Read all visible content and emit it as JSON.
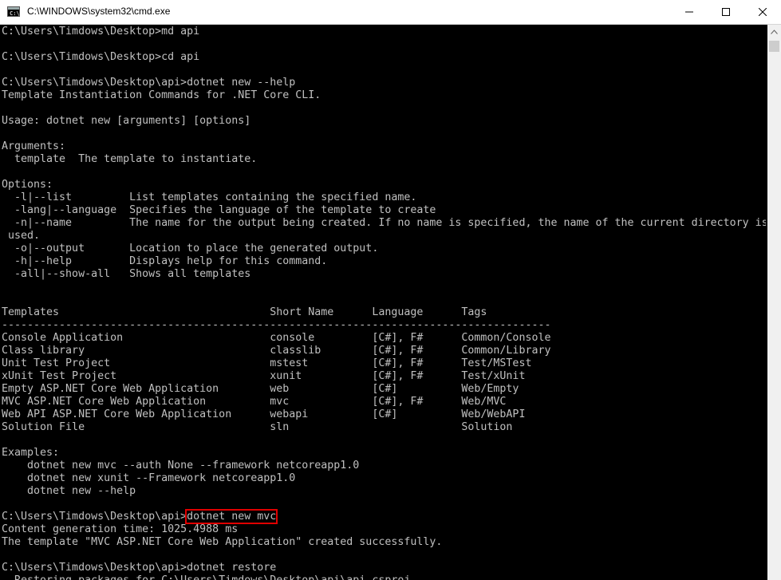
{
  "window": {
    "title": "C:\\WINDOWS\\system32\\cmd.exe",
    "icon": "cmd-icon",
    "controls": {
      "minimize": "minimize-icon",
      "maximize": "maximize-icon",
      "close": "close-icon"
    }
  },
  "console": {
    "lines": [
      "C:\\Users\\Timdows\\Desktop>md api",
      "",
      "C:\\Users\\Timdows\\Desktop>cd api",
      "",
      "C:\\Users\\Timdows\\Desktop\\api>dotnet new --help",
      "Template Instantiation Commands for .NET Core CLI.",
      "",
      "Usage: dotnet new [arguments] [options]",
      "",
      "Arguments:",
      "  template  The template to instantiate.",
      "",
      "Options:",
      "  -l|--list         List templates containing the specified name.",
      "  -lang|--language  Specifies the language of the template to create",
      "  -n|--name         The name for the output being created. If no name is specified, the name of the current directory is",
      " used.",
      "  -o|--output       Location to place the generated output.",
      "  -h|--help         Displays help for this command.",
      "  -all|--show-all   Shows all templates",
      "",
      "",
      "Templates                                 Short Name      Language      Tags",
      "--------------------------------------------------------------------------------------",
      "Console Application                       console         [C#], F#      Common/Console",
      "Class library                             classlib        [C#], F#      Common/Library",
      "Unit Test Project                         mstest          [C#], F#      Test/MSTest",
      "xUnit Test Project                        xunit           [C#], F#      Test/xUnit",
      "Empty ASP.NET Core Web Application        web             [C#]          Web/Empty",
      "MVC ASP.NET Core Web Application          mvc             [C#], F#      Web/MVC",
      "Web API ASP.NET Core Web Application      webapi          [C#]          Web/WebAPI",
      "Solution File                             sln                           Solution",
      "",
      "Examples:",
      "    dotnet new mvc --auth None --framework netcoreapp1.0",
      "    dotnet new xunit --Framework netcoreapp1.0",
      "    dotnet new --help",
      "",
      "C:\\Users\\Timdows\\Desktop\\api>dotnet new mvc",
      "Content generation time: 1025.4988 ms",
      "The template \"MVC ASP.NET Core Web Application\" created successfully.",
      "",
      "C:\\Users\\Timdows\\Desktop\\api>dotnet restore",
      "  Restoring packages for C:\\Users\\Timdows\\Desktop\\api\\api.csproj..."
    ],
    "highlight": {
      "line_index": 38,
      "prompt": "C:\\Users\\Timdows\\Desktop\\api>",
      "command": "dotnet new mvc",
      "color": "#e00000"
    },
    "text_color": "#c0c0c0",
    "background": "#000000"
  }
}
